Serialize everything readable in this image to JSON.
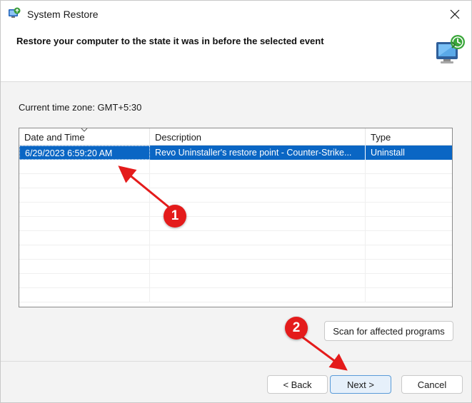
{
  "window": {
    "title": "System Restore"
  },
  "header": {
    "heading": "Restore your computer to the state it was in before the selected event"
  },
  "timezone": {
    "label": "Current time zone: GMT+5:30"
  },
  "table": {
    "columns": [
      "Date and Time",
      "Description",
      "Type"
    ],
    "rows": [
      {
        "date": "6/29/2023 6:59:20 AM",
        "description": "Revo Uninstaller's restore point - Counter-Strike...",
        "type": "Uninstall",
        "selected": true
      }
    ],
    "empty_row_count": 10
  },
  "buttons": {
    "scan": "Scan for affected programs",
    "back": "< Back",
    "next": "Next >",
    "cancel": "Cancel"
  },
  "annotations": {
    "badge1": "1",
    "badge2": "2",
    "color": "#e41b1b"
  },
  "colors": {
    "selection": "#0a66c4",
    "next_button_bg": "#e6f0fa"
  }
}
